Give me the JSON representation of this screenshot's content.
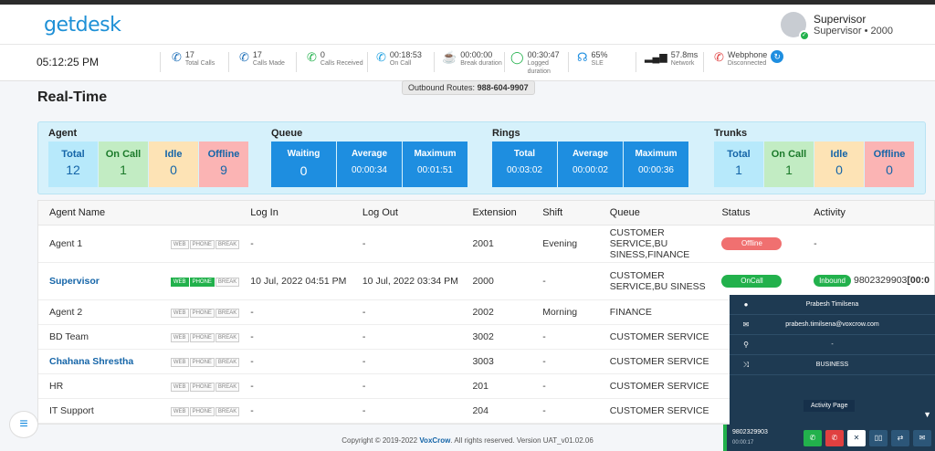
{
  "brand": {
    "logo": "getdesk"
  },
  "user": {
    "name": "Supervisor",
    "sub": "Supervisor • 2000"
  },
  "stats": {
    "clock": "05:12:25 PM",
    "total_calls": {
      "v": "17",
      "l": "Total Calls"
    },
    "calls_made": {
      "v": "17",
      "l": "Calls Made"
    },
    "calls_received": {
      "v": "0",
      "l": "Calls Received"
    },
    "on_call": {
      "v": "00:18:53",
      "l": "On Call"
    },
    "break": {
      "v": "00:00:00",
      "l": "Break duration"
    },
    "logged": {
      "v": "00:30:47",
      "l": "Logged duration"
    },
    "sle": {
      "v": "65%",
      "l": "SLE"
    },
    "network": {
      "v": "57.8ms",
      "l": "Network"
    },
    "webphone": {
      "v": "Webphone",
      "l": "Disconnected"
    }
  },
  "routes": {
    "label": "Outbound Routes:",
    "value": "988-604-9907"
  },
  "page_title": "Real-Time",
  "agent_group": {
    "title": "Agent",
    "total_l": "Total",
    "total_v": "12",
    "oncall_l": "On Call",
    "oncall_v": "1",
    "idle_l": "Idle",
    "idle_v": "0",
    "offline_l": "Offline",
    "offline_v": "9"
  },
  "queue_group": {
    "title": "Queue",
    "waiting_l": "Waiting",
    "waiting_v": "0",
    "average_l": "Average",
    "average_v": "00:00:34",
    "maximum_l": "Maximum",
    "maximum_v": "00:01:51"
  },
  "rings_group": {
    "title": "Rings",
    "total_l": "Total",
    "total_v": "00:03:02",
    "average_l": "Average",
    "average_v": "00:00:02",
    "maximum_l": "Maximum",
    "maximum_v": "00:00:36"
  },
  "trunks_group": {
    "title": "Trunks",
    "total_l": "Total",
    "total_v": "1",
    "oncall_l": "On Call",
    "oncall_v": "1",
    "idle_l": "Idle",
    "idle_v": "0",
    "offline_l": "Offline",
    "offline_v": "0"
  },
  "table": {
    "headers": [
      "Agent Name",
      "Log In",
      "Log Out",
      "Extension",
      "Shift",
      "Queue",
      "Status",
      "Activity"
    ],
    "tags": [
      "WEB",
      "PHONE",
      "BREAK"
    ],
    "rows": [
      {
        "name": "Agent 1",
        "login": "-",
        "logout": "-",
        "ext": "2001",
        "shift": "Evening",
        "queue": "CUSTOMER SERVICE,BU SINESS,FINANCE",
        "status": "Offline",
        "activity": "-"
      },
      {
        "name": "Supervisor",
        "login": "10 Jul, 2022 04:51 PM",
        "logout": "10 Jul, 2022 03:34 PM",
        "ext": "2000",
        "shift": "-",
        "queue": "CUSTOMER SERVICE,BU SINESS",
        "status": "OnCall",
        "activity_badge": "Inbound",
        "activity": "9802329903",
        "activity_bold": "[00:0"
      },
      {
        "name": "Agent 2",
        "login": "-",
        "logout": "-",
        "ext": "2002",
        "shift": "Morning",
        "queue": "FINANCE"
      },
      {
        "name": "BD Team",
        "login": "-",
        "logout": "-",
        "ext": "3002",
        "shift": "-",
        "queue": "CUSTOMER SERVICE"
      },
      {
        "name": "Chahana Shrestha",
        "login": "-",
        "logout": "-",
        "ext": "3003",
        "shift": "-",
        "queue": "CUSTOMER SERVICE"
      },
      {
        "name": "HR",
        "login": "-",
        "logout": "-",
        "ext": "201",
        "shift": "-",
        "queue": "CUSTOMER SERVICE"
      },
      {
        "name": "IT Support",
        "login": "-",
        "logout": "-",
        "ext": "204",
        "shift": "-",
        "queue": "CUSTOMER SERVICE"
      }
    ]
  },
  "popup": {
    "name": "Prabesh Timilsena",
    "email": "prabesh.timilsena@voxcrow.com",
    "location": "-",
    "queue": "BUSINESS",
    "activity_btn": "Activity Page"
  },
  "callbar": {
    "number": "9802329903",
    "duration": "00:00:17"
  },
  "footer": {
    "pre": "Copyright © 2019-2022",
    "brand": "VoxCrow",
    "post": ". All rights reserved. Version UAT_v01.02.06"
  }
}
